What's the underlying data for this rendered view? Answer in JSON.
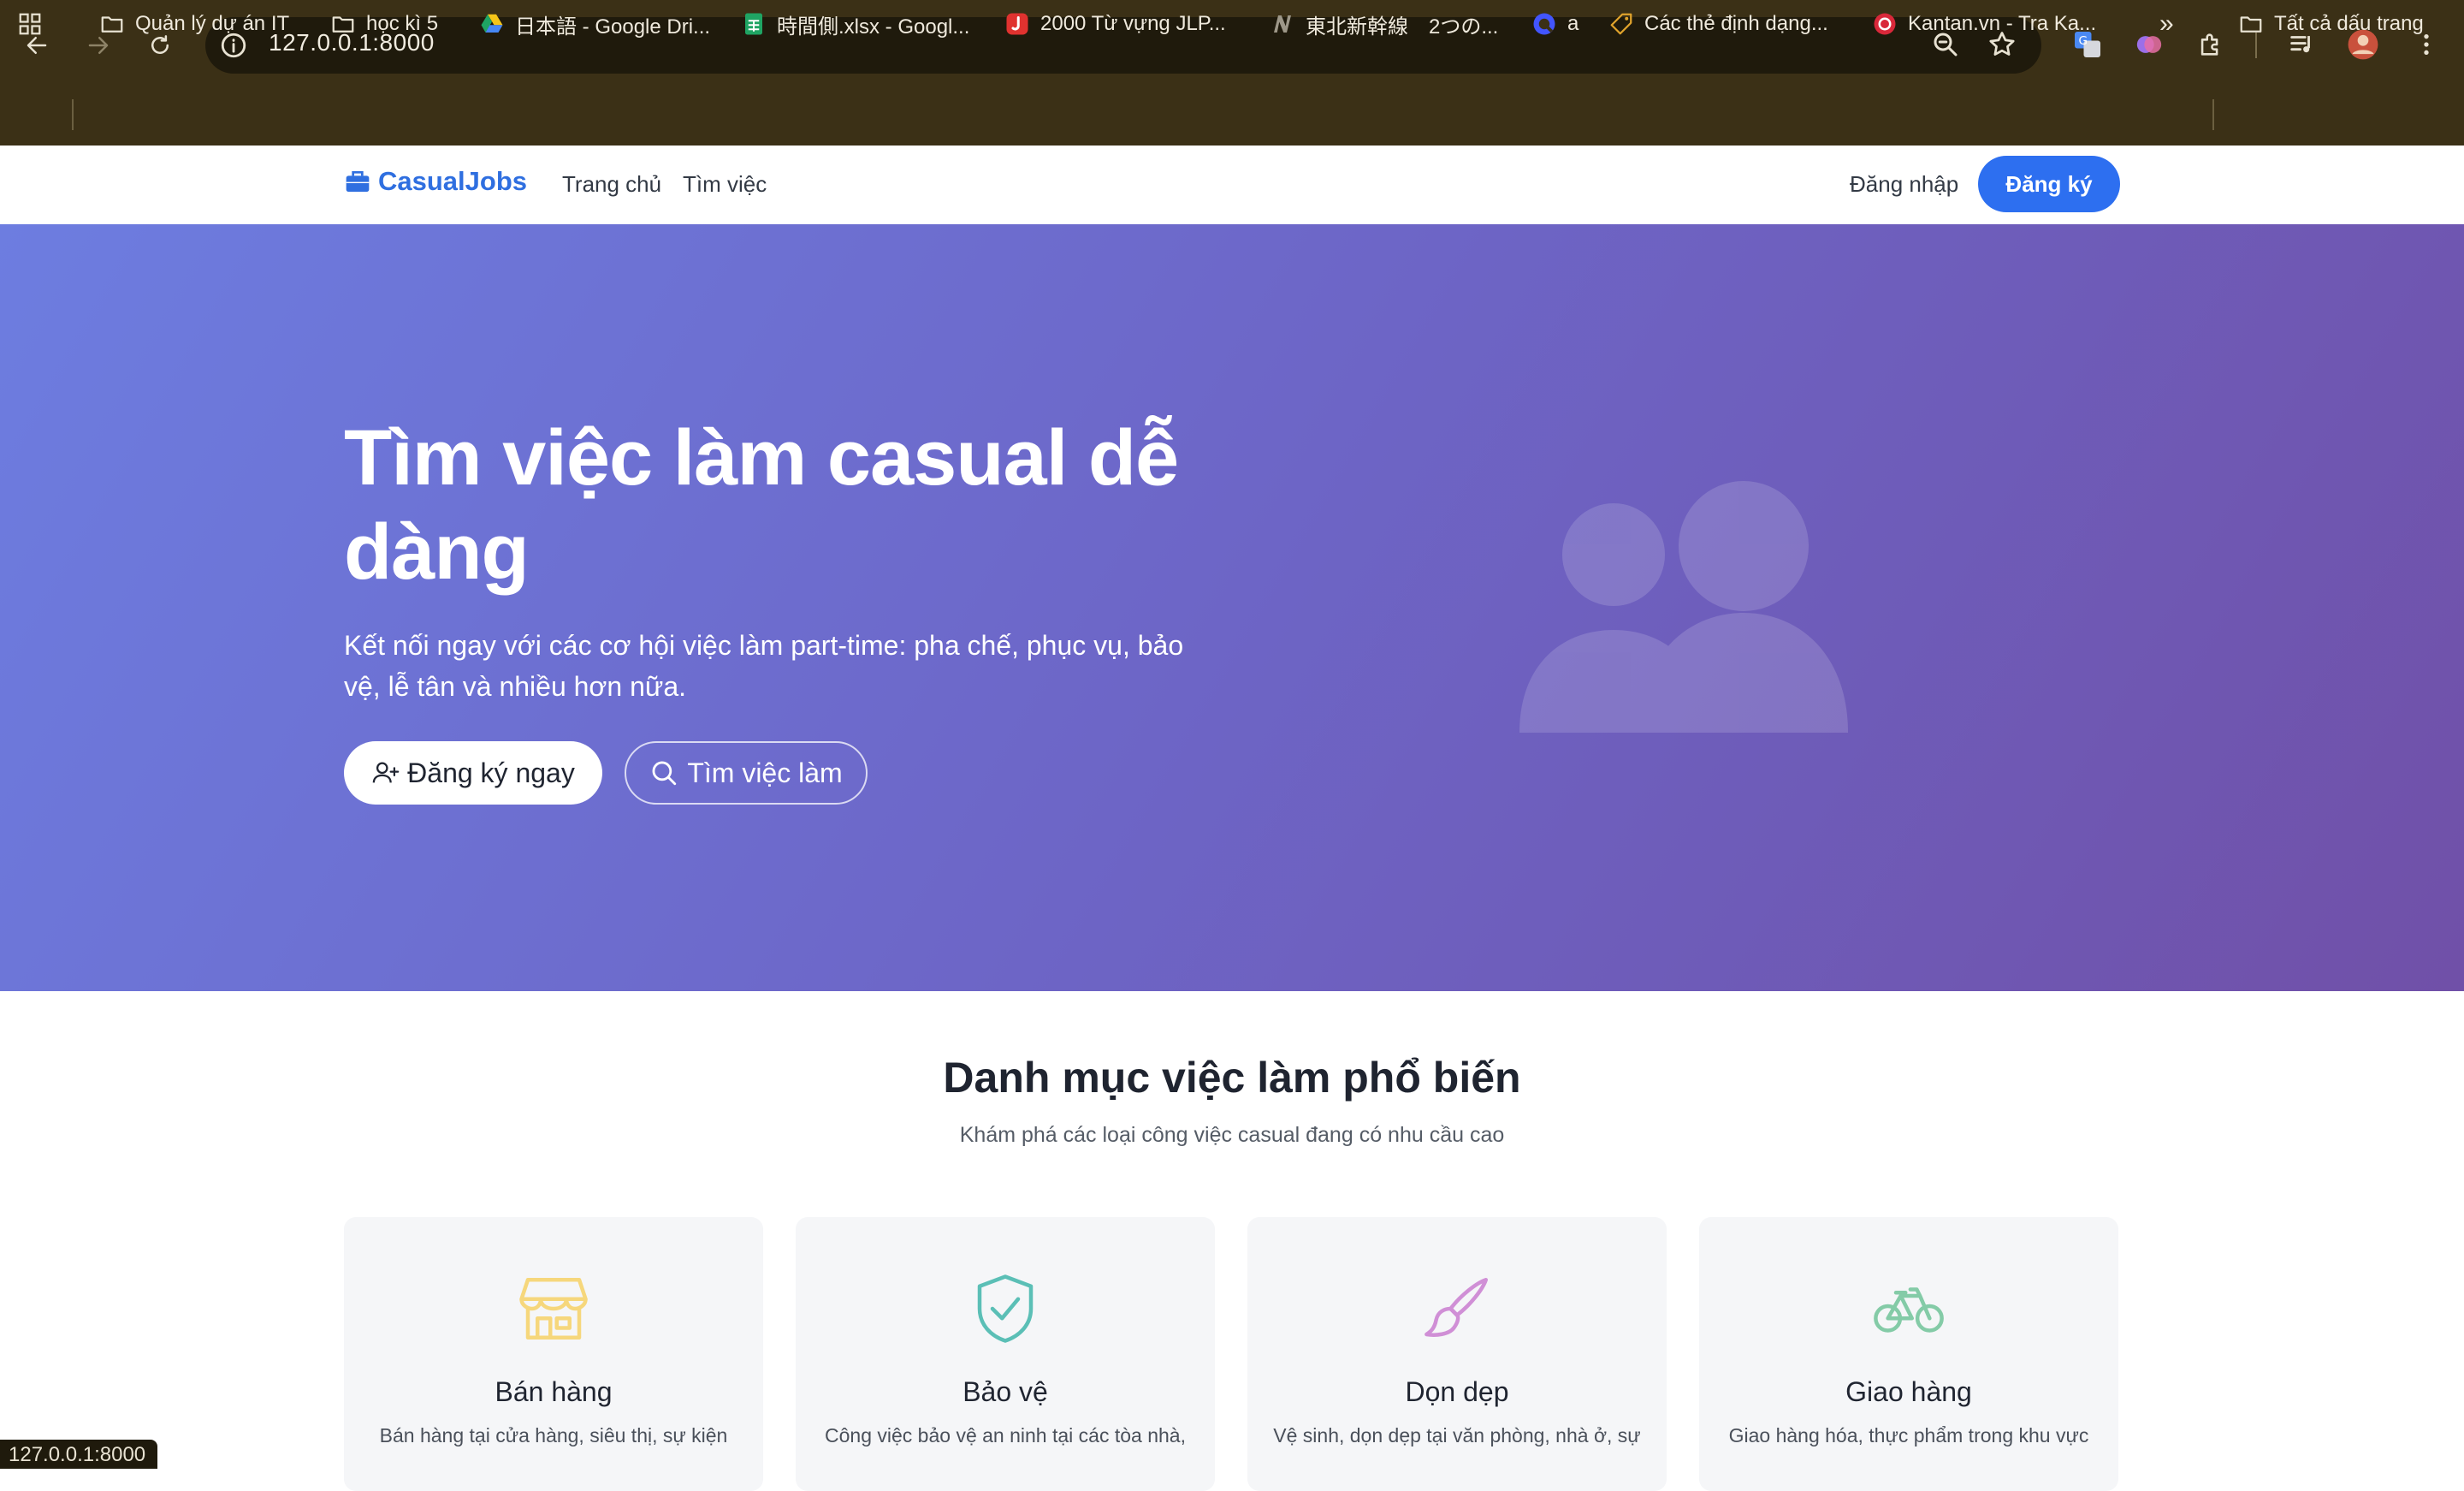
{
  "browser": {
    "url": "127.0.0.1:8000",
    "status_url": "127.0.0.1:8000",
    "bookmarks": [
      {
        "label": "Quản lý dự án IT",
        "icon": "folder-icon"
      },
      {
        "label": "học kì 5",
        "icon": "folder-icon"
      },
      {
        "label": "日本語 - Google Dri...",
        "icon": "google-drive-icon"
      },
      {
        "label": "時間側.xlsx - Googl...",
        "icon": "google-sheets-icon"
      },
      {
        "label": "2000 Từ vựng JLP...",
        "icon": "jlpt-app-icon"
      },
      {
        "label": "東北新幹線　2つの...",
        "icon": "n-site-icon"
      },
      {
        "label": "a",
        "icon": "quizlet-icon"
      },
      {
        "label": "Các thẻ định dạng...",
        "icon": "tag-icon"
      },
      {
        "label": "Kantan.vn - Tra Ka...",
        "icon": "kantan-icon"
      }
    ],
    "more_bookmarks": "»",
    "all_bookmarks": "Tất cả dấu trang",
    "colors": {
      "frame": "#3b3016",
      "omnibox": "#1f1a0c"
    }
  },
  "site": {
    "brand": "CasualJobs",
    "nav": [
      "Trang chủ",
      "Tìm việc"
    ],
    "login": "Đăng nhập",
    "register": "Đăng ký",
    "accent": "#2d6ff0"
  },
  "hero": {
    "title": "Tìm việc làm casual dễ dàng",
    "subtitle": "Kết nối ngay với các cơ hội việc làm part-time: pha chế, phục vụ, bảo vệ, lễ tân và nhiều hơn nữa.",
    "cta_primary": "Đăng ký ngay",
    "cta_secondary": "Tìm việc làm",
    "gradient": [
      "#6d7de0",
      "#7050a8"
    ]
  },
  "categories": {
    "title": "Danh mục việc làm phổ biến",
    "subtitle": "Khám phá các loại công việc casual đang có nhu cầu cao",
    "items": [
      {
        "title": "Bán hàng",
        "desc": "Bán hàng tại cửa hàng, siêu thị, sự kiện",
        "icon": "store-icon",
        "color": "#f6d77c"
      },
      {
        "title": "Bảo vệ",
        "desc": "Công việc bảo vệ an ninh tại các tòa nhà,",
        "icon": "shield-check-icon",
        "color": "#5bbfb6"
      },
      {
        "title": "Dọn dẹp",
        "desc": "Vệ sinh, dọn dẹp tại văn phòng, nhà ở, sự",
        "icon": "brush-icon",
        "color": "#d08fd6"
      },
      {
        "title": "Giao hàng",
        "desc": "Giao hàng hóa, thực phẩm trong khu vực",
        "icon": "bicycle-icon",
        "color": "#84cba7"
      }
    ]
  }
}
